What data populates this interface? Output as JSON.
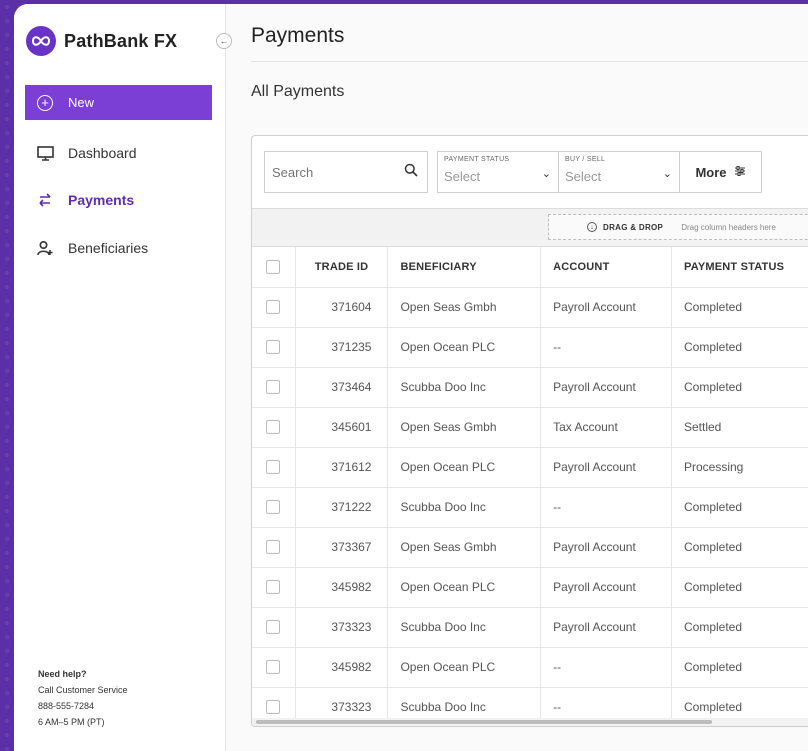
{
  "brand": {
    "name": "PathBank FX"
  },
  "sidebar": {
    "new_label": "New",
    "items": [
      {
        "label": "Dashboard",
        "icon": "monitor-icon",
        "active": false
      },
      {
        "label": "Payments",
        "icon": "swap-arrows-icon",
        "active": true
      },
      {
        "label": "Beneficiaries",
        "icon": "add-user-icon",
        "active": false
      }
    ],
    "help": {
      "heading": "Need help?",
      "line1": "Call Customer Service",
      "phone": "888-555-7284",
      "hours": "6 AM–5 PM (PT)"
    }
  },
  "header": {
    "title": "Payments",
    "section": "All Payments"
  },
  "filters": {
    "search_placeholder": "Search",
    "payment_status": {
      "label": "PAYMENT STATUS",
      "value": "Select"
    },
    "buy_sell": {
      "label": "BUY / SELL",
      "value": "Select"
    },
    "more_label": "More"
  },
  "dnd": {
    "label": "DRAG & DROP",
    "hint": "Drag column headers here"
  },
  "table": {
    "columns": [
      "TRADE ID",
      "BENEFICIARY",
      "ACCOUNT",
      "PAYMENT STATUS"
    ],
    "rows": [
      [
        "371604",
        "Open Seas Gmbh",
        "Payroll Account",
        "Completed"
      ],
      [
        "371235",
        "Open Ocean PLC",
        "--",
        "Completed"
      ],
      [
        "373464",
        "Scubba Doo Inc",
        "Payroll Account",
        "Completed"
      ],
      [
        "345601",
        "Open Seas Gmbh",
        "Tax Account",
        "Settled"
      ],
      [
        "371612",
        "Open Ocean PLC",
        "Payroll Account",
        "Processing"
      ],
      [
        "371222",
        "Scubba Doo Inc",
        "--",
        "Completed"
      ],
      [
        "373367",
        "Open Seas Gmbh",
        "Payroll Account",
        "Completed"
      ],
      [
        "345982",
        "Open Ocean PLC",
        "Payroll Account",
        "Completed"
      ],
      [
        "373323",
        "Scubba Doo Inc",
        "Payroll Account",
        "Completed"
      ],
      [
        "345982",
        "Open Ocean PLC",
        "--",
        "Completed"
      ],
      [
        "373323",
        "Scubba Doo Inc",
        "--",
        "Completed"
      ]
    ]
  },
  "colors": {
    "accent": "#7b3fd6",
    "frame": "#5b2fa8",
    "active_text": "#5e2db3"
  }
}
